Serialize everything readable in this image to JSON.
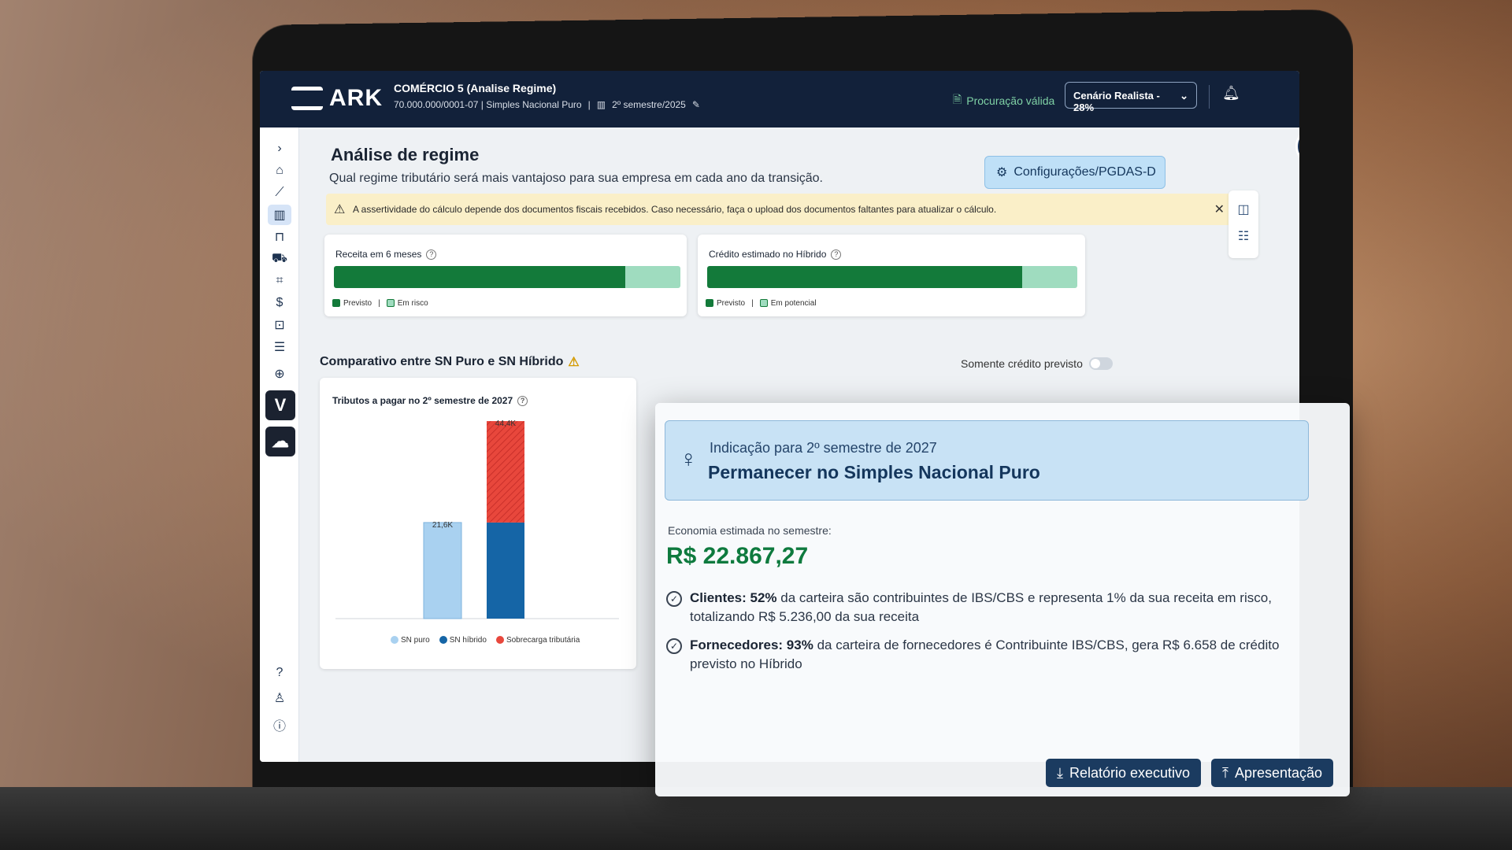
{
  "header": {
    "logo": "ARK",
    "company_name": "COMÉRCIO 5 (Analise Regime)",
    "company_meta": "70.000.000/0001-07 | Simples Nacional Puro",
    "period": "2º semestre/2025",
    "procuracao": "Procuração válida",
    "scenario": "Cenário Realista - 28%"
  },
  "page": {
    "title": "Análise de regime",
    "subtitle": "Qual regime tributário será mais vantajoso para sua empresa em cada ano da transição.",
    "config_button": "Configurações/PGDAS-D",
    "alert": "A assertividade do cálculo depende dos documentos fiscais recebidos. Caso necessário, faça o upload dos documentos faltantes para atualizar o cálculo."
  },
  "cards": {
    "receita": {
      "title": "Receita em 6 meses",
      "legend": [
        "Previsto",
        "Em risco"
      ],
      "previsto_fraction": 0.84
    },
    "credito": {
      "title": "Crédito estimado no Híbrido",
      "legend": [
        "Previsto",
        "Em potencial"
      ],
      "previsto_fraction": 0.85
    }
  },
  "comparison": {
    "title": "Comparativo entre SN Puro e SN Híbrido",
    "toggle_label": "Somente crédito previsto"
  },
  "chart_data": {
    "type": "bar",
    "title": "Tributos a pagar no 2º semestre de 2027",
    "categories": [
      "SN puro",
      "SN híbrido"
    ],
    "series": [
      {
        "name": "SN puro",
        "values": [
          21.6,
          0
        ]
      },
      {
        "name": "SN híbrido",
        "values": [
          0,
          21.6
        ]
      },
      {
        "name": "Sobrecarga tributária",
        "values": [
          0,
          22.8
        ]
      }
    ],
    "labels": [
      "21,6K",
      "44,4K"
    ],
    "ylim": [
      0,
      46
    ],
    "colors": {
      "sn_puro": "#a9d1f0",
      "sn_hibrido": "#1565a6",
      "sobrecarga": "#e8473c"
    }
  },
  "indication": {
    "label": "Indicação para 2º semestre de 2027",
    "value": "Permanecer no Simples Nacional Puro",
    "economy_label": "Economia estimada no semestre:",
    "economy_value": "R$ 22.867,27",
    "points": [
      {
        "bold": "Clientes: 52%",
        "text": " da carteira são contribuintes de IBS/CBS e representa 1% da sua receita em risco, totalizando R$ 5.236,00 da sua receita"
      },
      {
        "bold": "Fornecedores: 93%",
        "text": " da carteira de fornecedores é Contribuinte IBS/CBS, gera R$ 6.658 de crédito previsto no Híbrido"
      }
    ],
    "btn_report": "Relatório executivo",
    "btn_present": "Apresentação"
  },
  "colors": {
    "previsto": "#137a3a",
    "secondary": "#9fdcbf",
    "navy": "#12213a"
  }
}
